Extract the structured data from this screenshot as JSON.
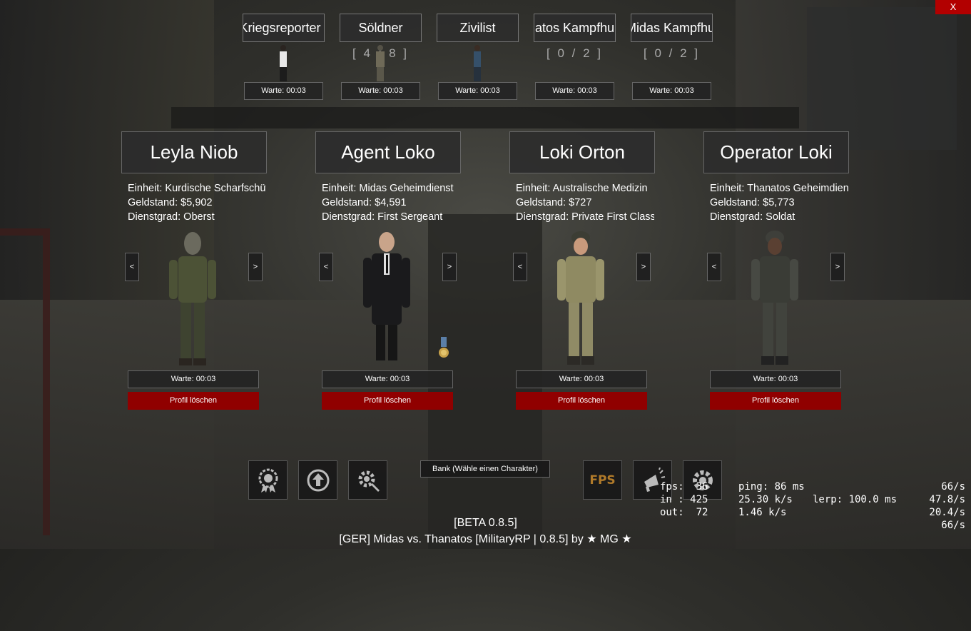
{
  "close_label": "X",
  "jobs": [
    {
      "name": "Kriegsreporter",
      "slots": "",
      "wait": "Warte: 00:03",
      "figure": "white-shirt"
    },
    {
      "name": "Söldner",
      "slots": "[ 4 / 8 ]",
      "wait": "Warte: 00:03",
      "figure": "camo"
    },
    {
      "name": "Zivilist",
      "slots": "",
      "wait": "Warte: 00:03",
      "figure": "blue"
    },
    {
      "name": "Thanatos Kampfhund",
      "slots": "[ 0 / 2 ]",
      "wait": "Warte: 00:03",
      "figure": ""
    },
    {
      "name": "Midas Kampfhund",
      "slots": "[ 0 / 2 ]",
      "wait": "Warte: 00:03",
      "figure": ""
    }
  ],
  "characters": [
    {
      "name": "Leyla Niob",
      "unit": "Einheit: Kurdische Scharfschützen",
      "money": "Geldstand: $5,902",
      "rank": "Dienstgrad: Oberst",
      "wait": "Warte: 00:03",
      "delete": "Profil löschen",
      "prev": "<",
      "next": ">",
      "outfit": "green"
    },
    {
      "name": "Agent Loko",
      "unit": "Einheit: Midas Geheimdienst",
      "money": "Geldstand: $4,591",
      "rank": "Dienstgrad: First Sergeant",
      "wait": "Warte: 00:03",
      "delete": "Profil löschen",
      "prev": "<",
      "next": ">",
      "outfit": "suit"
    },
    {
      "name": "Loki Orton",
      "unit": "Einheit: Australische Medizin",
      "money": "Geldstand: $727",
      "rank": "Dienstgrad: Private First Class",
      "wait": "Warte: 00:03",
      "delete": "Profil löschen",
      "prev": "<",
      "next": ">",
      "outfit": "desert"
    },
    {
      "name": "Operator Loki",
      "unit": "Einheit: Thanatos Geheimdienst",
      "money": "Geldstand: $5,773",
      "rank": "Dienstgrad: Soldat",
      "wait": "Warte: 00:03",
      "delete": "Profil löschen",
      "prev": "<",
      "next": ">",
      "outfit": "dark-camo"
    }
  ],
  "bottom_icons": [
    "medal-icon",
    "upload-icon",
    "gear-wrench-icon",
    "fps-icon",
    "megaphone-icon",
    "settings-icon"
  ],
  "fps_label": "FPS",
  "bank_label": "Bank (Wähle einen Charakter)",
  "netgraph": {
    "fps": "fps:  36",
    "ping": "ping: 86 ms",
    "rate1": "66/s",
    "in": "in : 425",
    "in_rate": "25.30 k/s",
    "lerp": "lerp: 100.0 ms",
    "rate2": "47.8/s",
    "out": "out:  72",
    "out_rate": "1.46 k/s",
    "rate3": "20.4/s",
    "rate4": "66/s"
  },
  "footer": {
    "version": "[BETA 0.8.5]",
    "server": "[GER] Midas vs. Thanatos [MilitaryRP | 0.8.5] by ★ MG ★"
  },
  "colors": {
    "delete": "#900000",
    "close": "#b20000",
    "fps_icon": "#b07a2a"
  }
}
